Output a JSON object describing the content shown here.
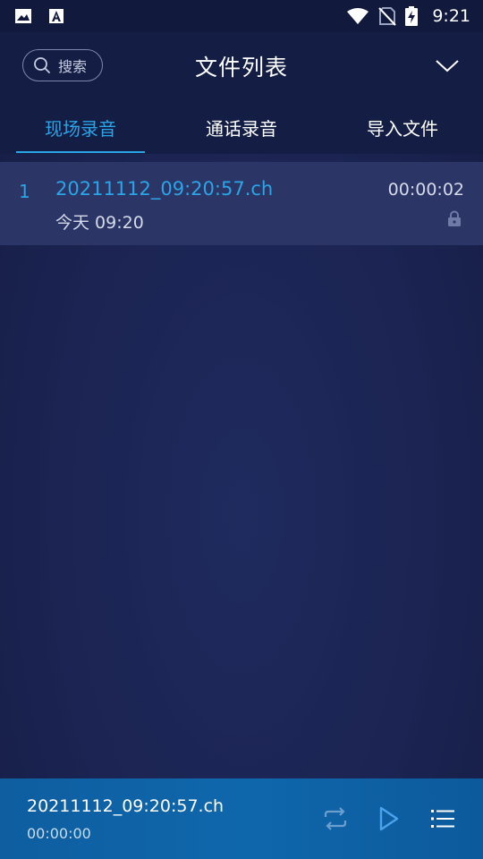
{
  "status_bar": {
    "time": "9:21",
    "icons": [
      "image-icon",
      "font-a-icon",
      "wifi-icon",
      "no-sim-icon",
      "battery-charging-icon"
    ]
  },
  "header": {
    "search_label": "搜索",
    "title": "文件列表"
  },
  "tabs": [
    {
      "label": "现场录音",
      "active": true
    },
    {
      "label": "通话录音",
      "active": false
    },
    {
      "label": "导入文件",
      "active": false
    }
  ],
  "files": [
    {
      "index": "1",
      "name": "20211112_09:20:57.ch",
      "date": "今天 09:20",
      "duration": "00:00:02",
      "locked": true
    }
  ],
  "player": {
    "file_name": "20211112_09:20:57.ch",
    "position": "00:00:00"
  },
  "colors": {
    "accent": "#2aa5e8",
    "background": "#1b2452",
    "row_highlight": "#2b3566",
    "player_bar": "#0f67ab"
  }
}
